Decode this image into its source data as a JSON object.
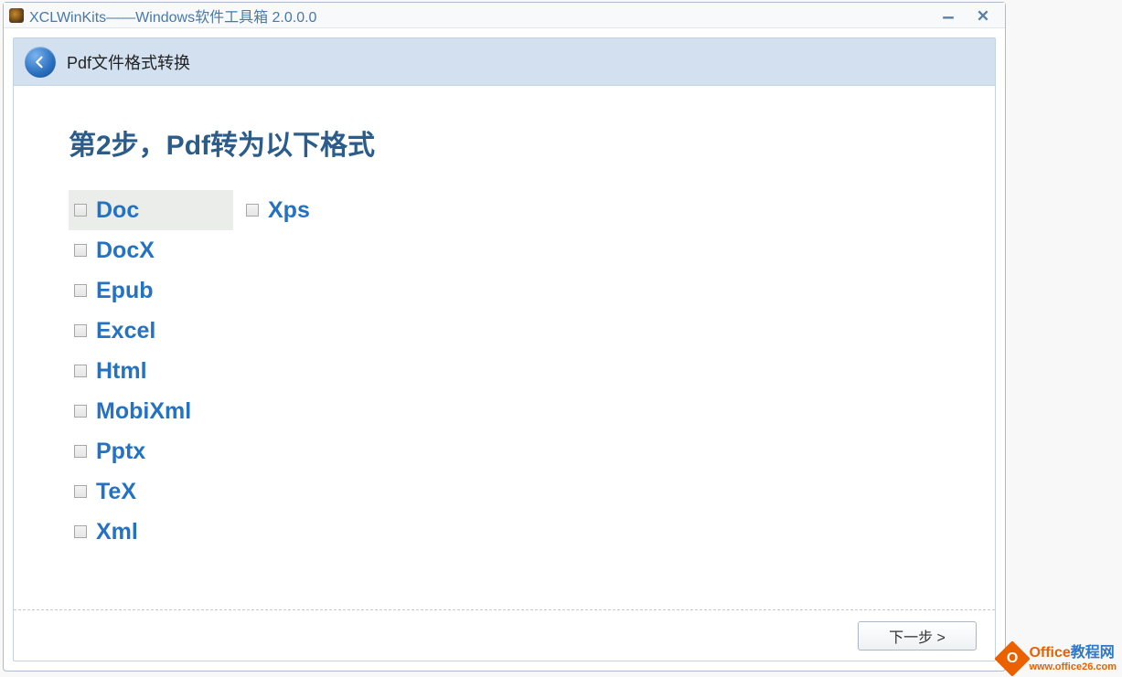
{
  "window": {
    "title": "XCLWinKits——Windows软件工具箱 2.0.0.0"
  },
  "panel": {
    "header_text": "Pdf文件格式转换",
    "step_title": "第2步，Pdf转为以下格式"
  },
  "formats": {
    "col1": [
      {
        "label": "Doc",
        "highlighted": true
      },
      {
        "label": "DocX",
        "highlighted": false
      },
      {
        "label": "Epub",
        "highlighted": false
      },
      {
        "label": "Excel",
        "highlighted": false
      },
      {
        "label": "Html",
        "highlighted": false
      },
      {
        "label": "MobiXml",
        "highlighted": false
      },
      {
        "label": "Pptx",
        "highlighted": false
      },
      {
        "label": "TeX",
        "highlighted": false
      },
      {
        "label": "Xml",
        "highlighted": false
      }
    ],
    "col2": [
      {
        "label": "Xps",
        "highlighted": false
      }
    ]
  },
  "footer": {
    "next_label": "下一步 >"
  },
  "watermark": {
    "brand_part1": "Office",
    "brand_part2": "教程网",
    "url": "www.office26.com",
    "icon_letter": "O"
  }
}
